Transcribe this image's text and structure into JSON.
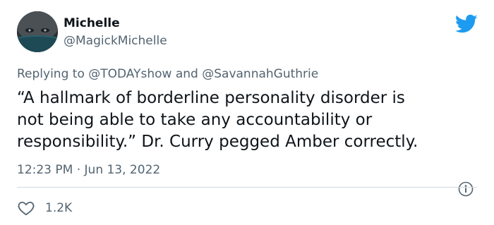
{
  "tweet": {
    "author": {
      "display_name": "Michelle",
      "handle": "@MagickMichelle"
    },
    "replying_to": {
      "prefix": "Replying to",
      "mentions": [
        "@TODAYshow",
        "@SavannahGuthrie"
      ],
      "joiner": "and"
    },
    "text": "“A hallmark of borderline personality disorder is\nnot being able to take any accountability or\nresponsibility.” Dr. Curry pegged Amber correctly.",
    "timestamp": "12:23 PM · Jun 13, 2022",
    "likes": "1.2K"
  },
  "icons": {
    "brand": "twitter-bird-icon",
    "info": "info-icon",
    "like": "heart-icon"
  },
  "colors": {
    "brand": "#1d9bf0",
    "text": "#0f1419",
    "secondary": "#536471",
    "divider": "#cfd9de"
  }
}
